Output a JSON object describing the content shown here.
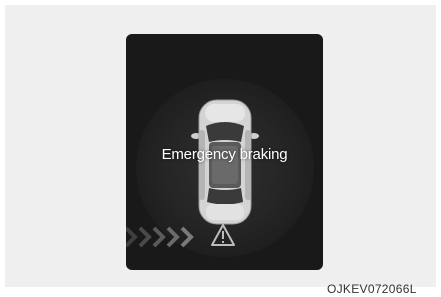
{
  "display": {
    "message": "Emergency braking",
    "icons": {
      "car": "car-top-view-icon",
      "approach": "chevron-right-icon",
      "warning": "warning-triangle-icon"
    },
    "colors": {
      "screen": "#191919",
      "text": "#ffffff",
      "chevron": "#6b6b6b"
    }
  },
  "figure_code": "OJKEV072066L"
}
